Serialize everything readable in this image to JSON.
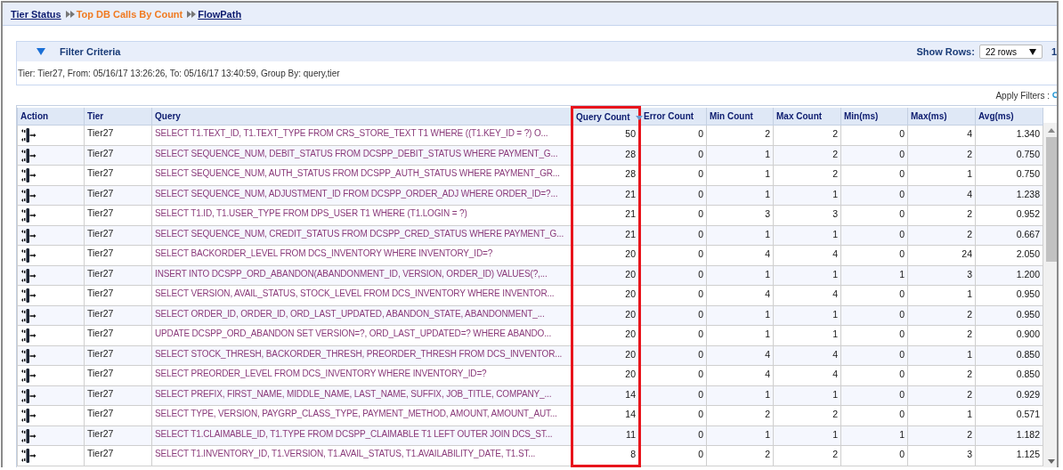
{
  "breadcrumb": [
    {
      "label": "Tier Status",
      "current": false
    },
    {
      "label": "Top DB Calls By Count",
      "current": true
    },
    {
      "label": "FlowPath",
      "current": false
    }
  ],
  "filter": {
    "title": "Filter Criteria",
    "expanded": true,
    "summary": "Tier: Tier27, From: 05/16/17 13:26:26, To: 05/16/17 13:40:59, Group By: query,tier",
    "show_rows_label": "Show Rows:",
    "show_rows_value": "22 rows",
    "page": "1"
  },
  "apply_filters": "Apply Filters :",
  "table": {
    "columns": [
      {
        "label": "Action",
        "highlighted": false,
        "sorted": false
      },
      {
        "label": "Tier",
        "highlighted": false,
        "sorted": false
      },
      {
        "label": "Query",
        "highlighted": false,
        "sorted": false
      },
      {
        "label": "Query Count",
        "highlighted": true,
        "sorted": true
      },
      {
        "label": "Error Count",
        "highlighted": false,
        "sorted": false
      },
      {
        "label": "Min Count",
        "highlighted": false,
        "sorted": false
      },
      {
        "label": "Max Count",
        "highlighted": false,
        "sorted": false
      },
      {
        "label": "Min(ms)",
        "highlighted": false,
        "sorted": false
      },
      {
        "label": "Max(ms)",
        "highlighted": false,
        "sorted": false
      },
      {
        "label": "Avg(ms)",
        "highlighted": false,
        "sorted": false
      }
    ],
    "rows": [
      {
        "tier": "Tier27",
        "query": "SELECT T1.TEXT_ID, T1.TEXT_TYPE FROM CRS_STORE_TEXT T1 WHERE ((T1.KEY_ID = ?) O...",
        "values": [
          "50",
          "0",
          "2",
          "2",
          "0",
          "4",
          "1.340"
        ]
      },
      {
        "tier": "Tier27",
        "query": "SELECT SEQUENCE_NUM, DEBIT_STATUS FROM DCSPP_DEBIT_STATUS WHERE PAYMENT_G...",
        "values": [
          "28",
          "0",
          "1",
          "2",
          "0",
          "2",
          "0.750"
        ]
      },
      {
        "tier": "Tier27",
        "query": "SELECT SEQUENCE_NUM, AUTH_STATUS FROM DCSPP_AUTH_STATUS WHERE PAYMENT_GR...",
        "values": [
          "28",
          "0",
          "1",
          "2",
          "0",
          "1",
          "0.750"
        ]
      },
      {
        "tier": "Tier27",
        "query": "SELECT SEQUENCE_NUM, ADJUSTMENT_ID FROM DCSPP_ORDER_ADJ WHERE ORDER_ID=?...",
        "values": [
          "21",
          "0",
          "1",
          "1",
          "0",
          "4",
          "1.238"
        ]
      },
      {
        "tier": "Tier27",
        "query": "SELECT T1.ID, T1.USER_TYPE FROM DPS_USER T1 WHERE (T1.LOGIN = ?)",
        "values": [
          "21",
          "0",
          "3",
          "3",
          "0",
          "2",
          "0.952"
        ]
      },
      {
        "tier": "Tier27",
        "query": "SELECT SEQUENCE_NUM, CREDIT_STATUS FROM DCSPP_CRED_STATUS WHERE PAYMENT_G...",
        "values": [
          "21",
          "0",
          "1",
          "1",
          "0",
          "2",
          "0.667"
        ]
      },
      {
        "tier": "Tier27",
        "query": "SELECT BACKORDER_LEVEL FROM DCS_INVENTORY WHERE INVENTORY_ID=?",
        "values": [
          "20",
          "0",
          "4",
          "4",
          "0",
          "24",
          "2.050"
        ]
      },
      {
        "tier": "Tier27",
        "query": "INSERT INTO DCSPP_ORD_ABANDON(ABANDONMENT_ID, VERSION, ORDER_ID) VALUES(?,...",
        "values": [
          "20",
          "0",
          "1",
          "1",
          "1",
          "3",
          "1.200"
        ]
      },
      {
        "tier": "Tier27",
        "query": "SELECT VERSION, AVAIL_STATUS, STOCK_LEVEL FROM DCS_INVENTORY WHERE INVENTOR...",
        "values": [
          "20",
          "0",
          "4",
          "4",
          "0",
          "1",
          "0.950"
        ]
      },
      {
        "tier": "Tier27",
        "query": "SELECT ORDER_ID, ORDER_ID, ORD_LAST_UPDATED, ABANDON_STATE, ABANDONMENT_...",
        "values": [
          "20",
          "0",
          "1",
          "1",
          "0",
          "2",
          "0.950"
        ]
      },
      {
        "tier": "Tier27",
        "query": "UPDATE DCSPP_ORD_ABANDON SET VERSION=?, ORD_LAST_UPDATED=? WHERE ABANDO...",
        "values": [
          "20",
          "0",
          "1",
          "1",
          "0",
          "2",
          "0.900"
        ]
      },
      {
        "tier": "Tier27",
        "query": "SELECT STOCK_THRESH, BACKORDER_THRESH, PREORDER_THRESH FROM DCS_INVENTOR...",
        "values": [
          "20",
          "0",
          "4",
          "4",
          "0",
          "1",
          "0.850"
        ]
      },
      {
        "tier": "Tier27",
        "query": "SELECT PREORDER_LEVEL FROM DCS_INVENTORY WHERE INVENTORY_ID=?",
        "values": [
          "20",
          "0",
          "4",
          "4",
          "0",
          "2",
          "0.850"
        ]
      },
      {
        "tier": "Tier27",
        "query": "SELECT PREFIX, FIRST_NAME, MIDDLE_NAME, LAST_NAME, SUFFIX, JOB_TITLE, COMPANY_...",
        "values": [
          "14",
          "0",
          "1",
          "1",
          "0",
          "2",
          "0.929"
        ]
      },
      {
        "tier": "Tier27",
        "query": "SELECT TYPE, VERSION, PAYGRP_CLASS_TYPE, PAYMENT_METHOD, AMOUNT, AMOUNT_AUT...",
        "values": [
          "14",
          "0",
          "2",
          "2",
          "0",
          "1",
          "0.571"
        ]
      },
      {
        "tier": "Tier27",
        "query": "SELECT T1.CLAIMABLE_ID, T1.TYPE FROM DCSPP_CLAIMABLE T1 LEFT OUTER JOIN DCS_ST...",
        "values": [
          "11",
          "0",
          "1",
          "1",
          "1",
          "2",
          "1.182"
        ]
      },
      {
        "tier": "Tier27",
        "query": "SELECT T1.INVENTORY_ID, T1.VERSION, T1.AVAIL_STATUS, T1.AVAILABILITY_DATE, T1.ST...",
        "values": [
          "8",
          "0",
          "2",
          "2",
          "0",
          "3",
          "1.125"
        ]
      }
    ]
  }
}
